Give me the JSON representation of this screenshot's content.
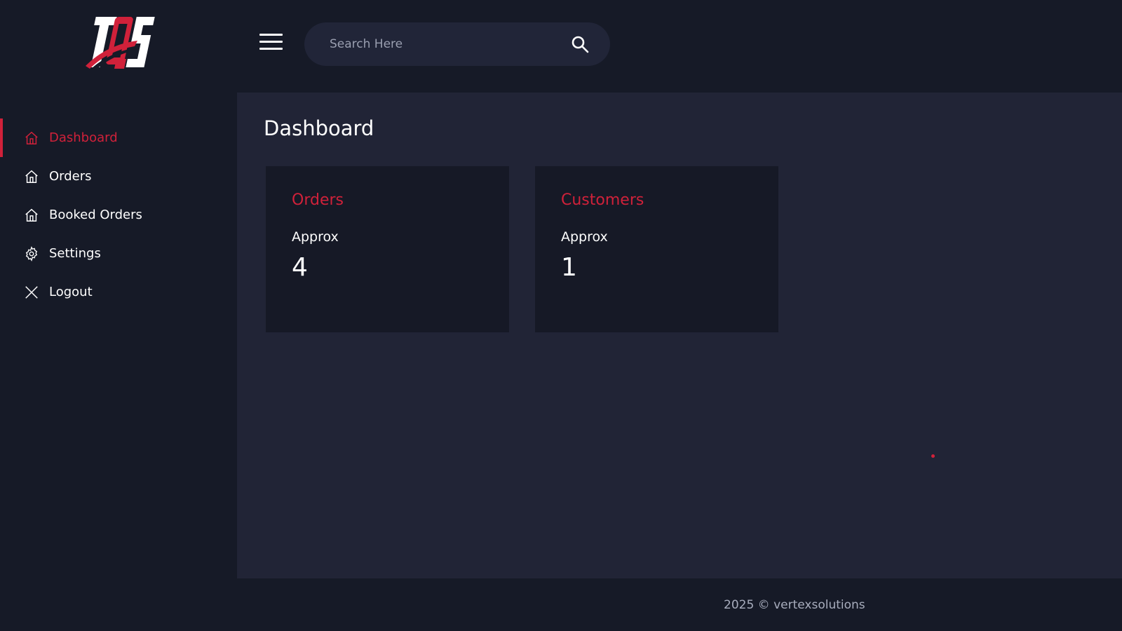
{
  "brand": {
    "logo_text": "TQS",
    "accent_color": "#d0213a"
  },
  "sidebar": {
    "items": [
      {
        "label": "Dashboard",
        "icon": "home-icon",
        "active": true
      },
      {
        "label": "Orders",
        "icon": "home-icon",
        "active": false
      },
      {
        "label": "Booked Orders",
        "icon": "home-icon",
        "active": false
      },
      {
        "label": "Settings",
        "icon": "gear-icon",
        "active": false
      },
      {
        "label": "Logout",
        "icon": "close-icon",
        "active": false
      }
    ]
  },
  "header": {
    "search": {
      "placeholder": "Search Here",
      "value": ""
    }
  },
  "main": {
    "title": "Dashboard",
    "cards": [
      {
        "title": "Orders",
        "label": "Approx",
        "value": "4"
      },
      {
        "title": "Customers",
        "label": "Approx",
        "value": "1"
      }
    ]
  },
  "footer": {
    "text": "2025 © vertexsolutions"
  }
}
